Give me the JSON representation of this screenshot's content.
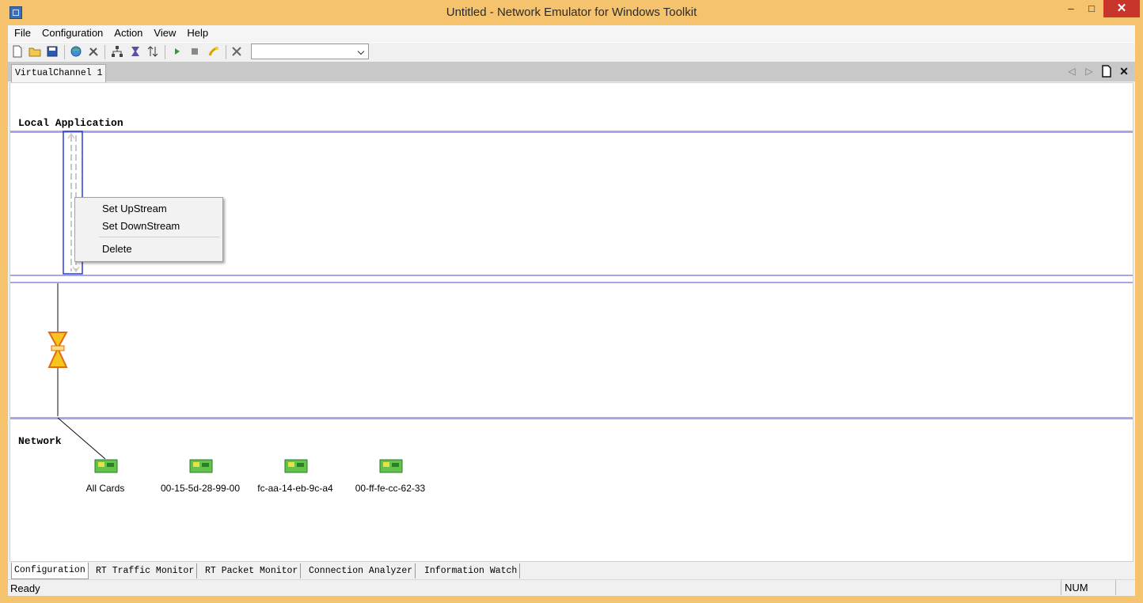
{
  "window": {
    "title": "Untitled - Network Emulator for Windows Toolkit"
  },
  "menu": {
    "items": [
      "File",
      "Configuration",
      "Action",
      "View",
      "Help"
    ]
  },
  "toolbar": {
    "buttons": [
      "new-icon",
      "open-icon",
      "save-icon",
      "globe-icon",
      "tools-icon",
      "network-icon",
      "filter-icon",
      "sort-icon",
      "play-icon",
      "stop-icon",
      "wizard-icon",
      "disconnect-icon"
    ],
    "combo_value": ""
  },
  "doc_tab": {
    "label": "VirtualChannel 1"
  },
  "canvas": {
    "local_label": "Local Application",
    "network_label": "Network"
  },
  "context_menu": {
    "items": [
      "Set UpStream",
      "Set DownStream",
      "Delete"
    ]
  },
  "cards": [
    {
      "name": "All Cards"
    },
    {
      "name": "00-15-5d-28-99-00"
    },
    {
      "name": "fc-aa-14-eb-9c-a4"
    },
    {
      "name": "00-ff-fe-cc-62-33"
    }
  ],
  "bottom_tabs": [
    "Configuration",
    "RT Traffic Monitor",
    "RT Packet Monitor",
    "Connection Analyzer",
    "Information Watch"
  ],
  "status": {
    "text": "Ready",
    "num": "NUM"
  }
}
